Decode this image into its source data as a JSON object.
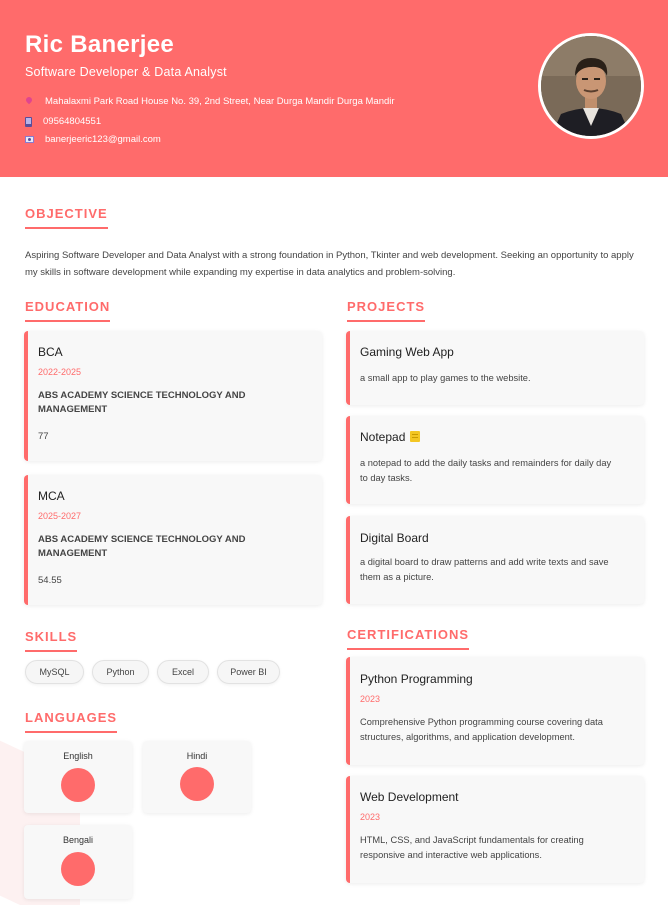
{
  "header": {
    "name": "Ric Banerjee",
    "role": "Software Developer & Data Analyst",
    "address": "Mahalaxmi Park Road House No. 39, 2nd Street, Near Durga Mandir Durga Mandir",
    "phone": "09564804551",
    "email": "banerjeeric123@gmail.com"
  },
  "objective": {
    "title": "OBJECTIVE",
    "text": "Aspiring Software Developer and Data Analyst with a strong foundation in Python, Tkinter and web development. Seeking an opportunity to apply my skills in software development while expanding my expertise in data analytics and problem-solving."
  },
  "education": {
    "title": "EDUCATION",
    "items": [
      {
        "degree": "BCA",
        "years": "2022-2025",
        "school": "ABS ACADEMY SCIENCE TECHNOLOGY AND MANAGEMENT",
        "score": "77"
      },
      {
        "degree": "MCA",
        "years": "2025-2027",
        "school": "ABS ACADEMY SCIENCE TECHNOLOGY AND MANAGEMENT",
        "score": "54.55"
      }
    ]
  },
  "projects": {
    "title": "PROJECTS",
    "items": [
      {
        "name": "Gaming Web App",
        "desc": "a small app to play games to the website."
      },
      {
        "name": "Notepad",
        "desc": "a notepad to add the daily tasks and remainders for daily day to day tasks."
      },
      {
        "name": "Digital Board",
        "desc": "a digital board to draw patterns and add write texts and save them as a picture."
      }
    ]
  },
  "skills": {
    "title": "SKILLS",
    "items": [
      "MySQL",
      "Python",
      "Excel",
      "Power BI"
    ]
  },
  "certifications": {
    "title": "CERTIFICATIONS",
    "items": [
      {
        "name": "Python Programming",
        "year": "2023",
        "desc": "Comprehensive Python programming course covering data structures, algorithms, and application development."
      },
      {
        "name": "Web Development",
        "year": "2023",
        "desc": "HTML, CSS, and JavaScript fundamentals for creating responsive and interactive web applications."
      }
    ]
  },
  "languages": {
    "title": "LANGUAGES",
    "items": [
      "English",
      "Hindi",
      "Bengali"
    ]
  },
  "colors": {
    "accent": "#ff6b6b",
    "card": "#f8f8f8"
  }
}
